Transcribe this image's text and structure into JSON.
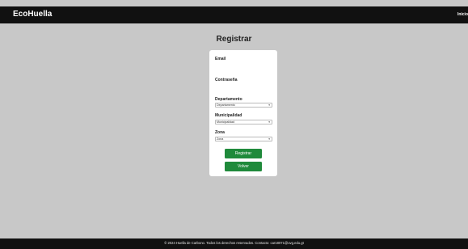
{
  "header": {
    "brand": "EcoHuella",
    "nav_link": "Inicio"
  },
  "page": {
    "title": "Registrar"
  },
  "form": {
    "email_label": "Email",
    "password_label": "Contraseña",
    "departamento_label": "Departamento",
    "departamento_value": "Departamento",
    "municipalidad_label": "Municipalidad",
    "municipalidad_value": "Municipalidad",
    "zona_label": "Zona",
    "zona_value": "Zona",
    "register_button": "Registrar",
    "back_button": "Volver"
  },
  "footer": {
    "text": "© 2024 Huella de Carbono. Todos los derechos reservados. Contacto: car18071@uvg.edu.gt"
  },
  "colors": {
    "background": "#c8c8c8",
    "header": "#111111",
    "button": "#1f8a3b"
  },
  "icons": {
    "select_chevron": "chevron-down-icon"
  }
}
